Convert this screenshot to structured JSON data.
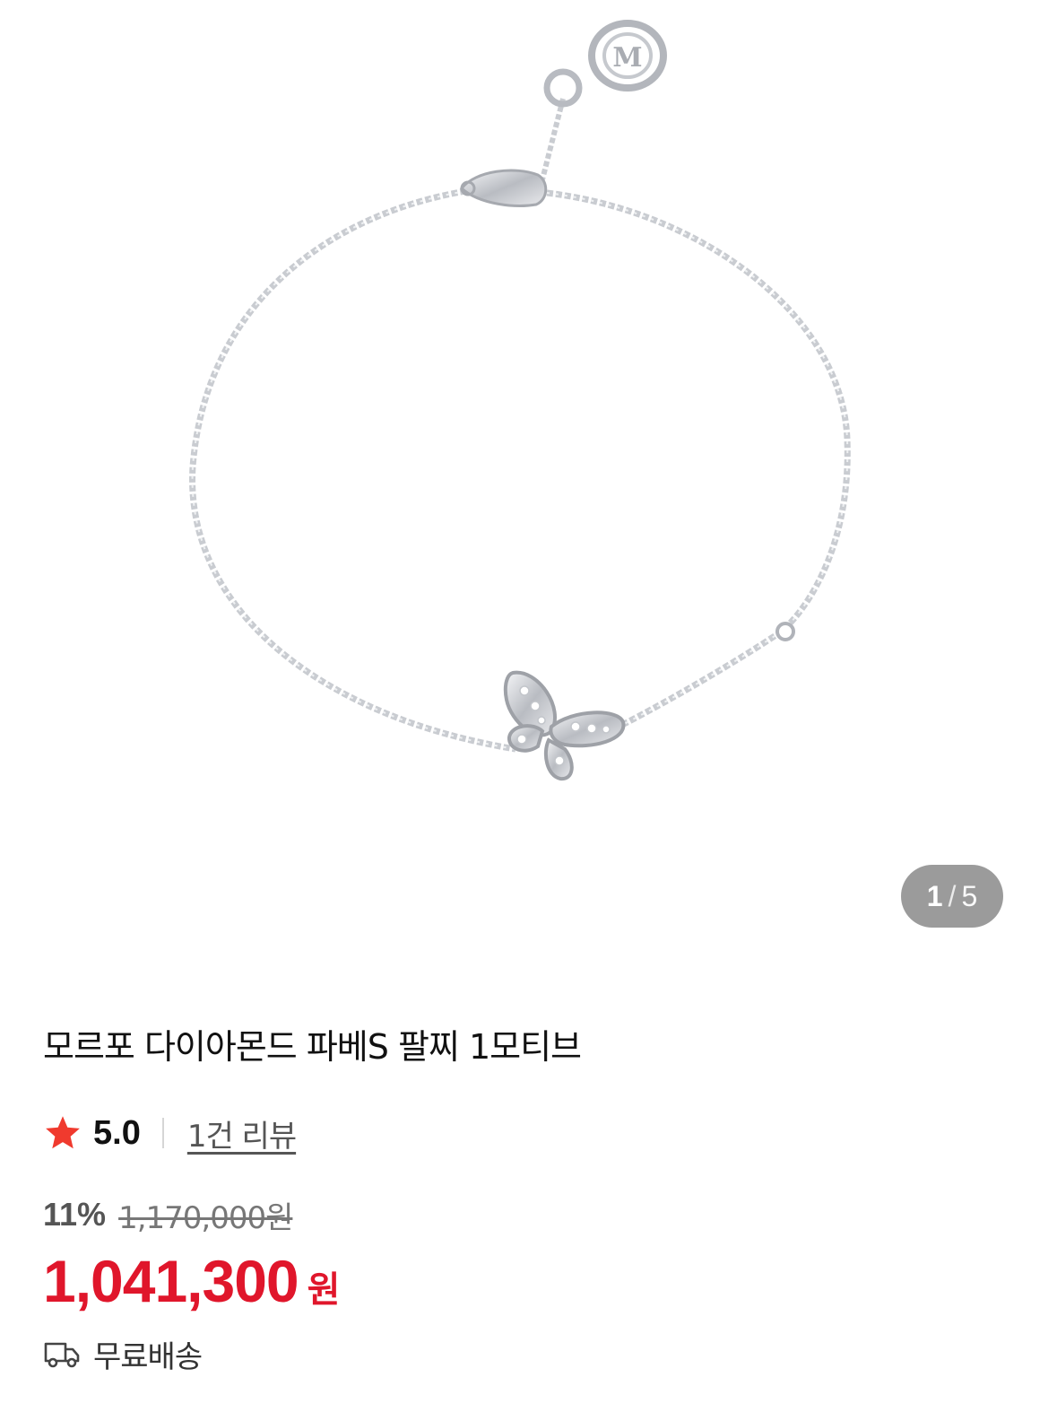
{
  "gallery": {
    "current": "1",
    "separator": "/",
    "total": "5"
  },
  "product": {
    "title": "모르포 다이아몬드 파베S 팔찌 1모티브"
  },
  "rating": {
    "score": "5.0",
    "reviews_link": "1건 리뷰"
  },
  "price": {
    "discount": "11%",
    "original": "1,170,000원",
    "sale": "1,041,300",
    "currency": "원"
  },
  "shipping": {
    "label": "무료배송",
    "icon": "truck-icon"
  },
  "colors": {
    "accent_red": "#e0162b",
    "star": "#f03a2e",
    "counter_bg": "#9b9b9b"
  }
}
